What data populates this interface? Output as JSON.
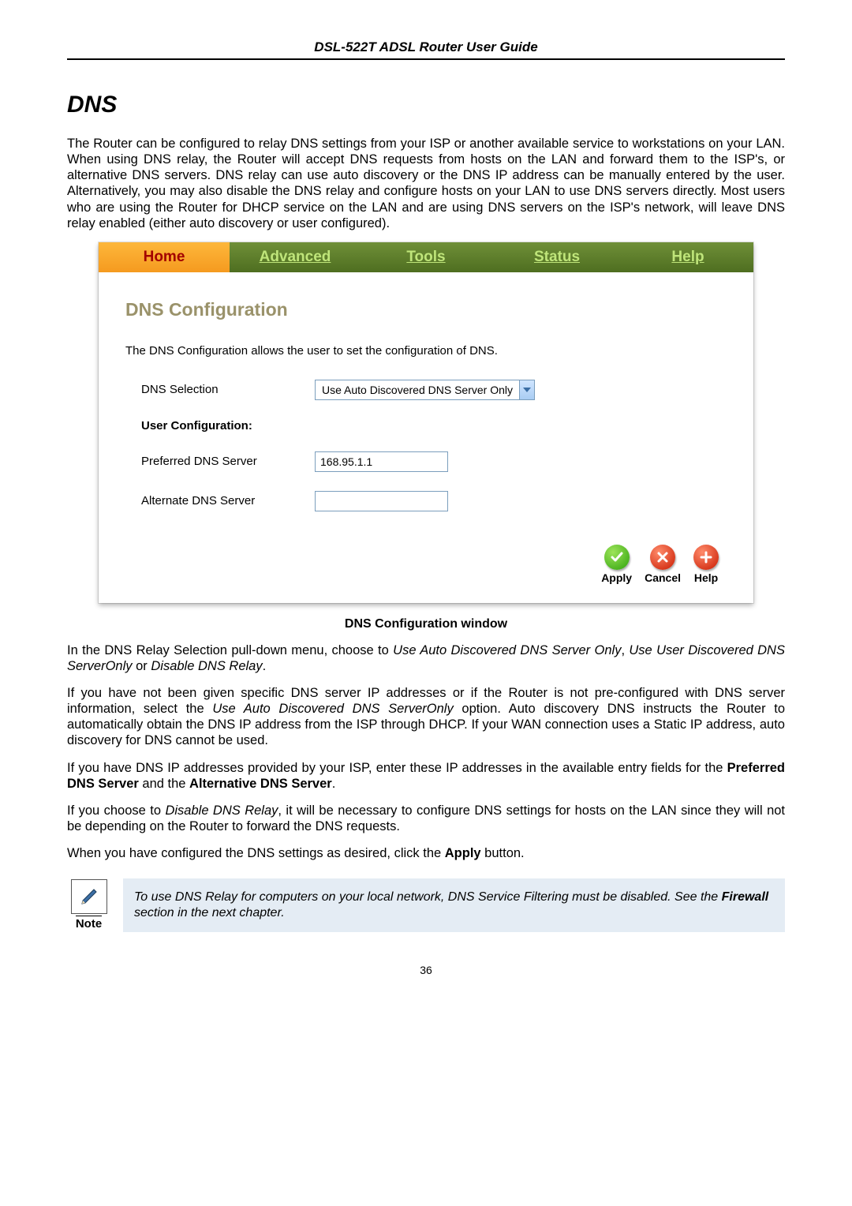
{
  "doc_header": "DSL-522T ADSL Router User Guide",
  "section_title": "DNS",
  "intro_paragraph": "The Router can be configured to relay DNS settings from your ISP or another available service to workstations on your LAN. When using DNS relay, the Router will accept DNS requests from hosts on the LAN and forward them to the ISP's, or alternative DNS servers. DNS relay can use auto discovery or the DNS IP address can be manually entered by the user. Alternatively, you may also disable the DNS relay and configure hosts on your LAN to use DNS servers directly. Most users who are using the Router for DHCP service on the LAN and are using DNS servers on the ISP's network, will leave DNS relay enabled (either auto discovery or user configured).",
  "tabs": {
    "home": "Home",
    "advanced": "Advanced",
    "tools": "Tools",
    "status": "Status",
    "help": "Help"
  },
  "panel": {
    "title": "DNS Configuration",
    "description": "The DNS Configuration allows the user to set the configuration of DNS.",
    "dns_selection_label": "DNS Selection",
    "dns_selection_value": "Use Auto Discovered DNS Server Only",
    "user_config_label": "User Configuration:",
    "preferred_label": "Preferred DNS Server",
    "preferred_value": "168.95.1.1",
    "alternate_label": "Alternate DNS Server",
    "alternate_value": "",
    "buttons": {
      "apply": "Apply",
      "cancel": "Cancel",
      "help": "Help"
    }
  },
  "caption": "DNS Configuration window",
  "para2_prefix": "In the DNS Relay Selection pull-down menu, choose to ",
  "para2_i1": "Use Auto Discovered DNS Server Only",
  "para2_sep1": ", ",
  "para2_i2": "Use User Discovered DNS ServerOnly",
  "para2_sep2": " or ",
  "para2_i3": "Disable DNS Relay",
  "para2_end": ".",
  "para3_prefix": "If you have not been given specific DNS server IP addresses or if the Router is not pre-configured with DNS server information, select the ",
  "para3_i1": "Use Auto Discovered DNS ServerOnly",
  "para3_suffix": " option. Auto discovery DNS instructs the Router to automatically obtain the DNS IP address from the ISP through DHCP. If your WAN connection uses a Static IP address, auto discovery for DNS cannot be used.",
  "para4_prefix": "If you have DNS IP addresses provided by your ISP, enter these IP addresses in the available entry fields for the ",
  "para4_b1": "Preferred DNS Server",
  "para4_mid": " and the ",
  "para4_b2": "Alternative DNS Server",
  "para4_end": ".",
  "para5_prefix": "If you choose to ",
  "para5_i1": "Disable DNS Relay",
  "para5_suffix": ", it will be necessary to configure DNS settings for hosts on the LAN since they will not be depending on the Router to forward the DNS requests.",
  "para6_prefix": "When you have configured the DNS settings as desired, click the ",
  "para6_b1": "Apply",
  "para6_suffix": " button.",
  "note_label": "Note",
  "note_prefix": "To use DNS Relay for computers on your local network, DNS Service Filtering must be disabled. See the ",
  "note_bold": "Firewall",
  "note_suffix": " section in the next chapter.",
  "page_number": "36"
}
